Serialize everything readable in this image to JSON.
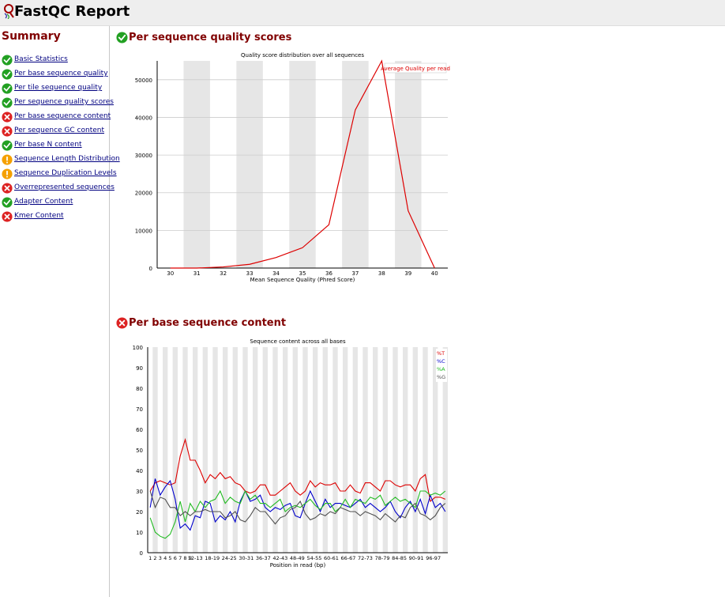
{
  "header": {
    "title": "FastQC Report"
  },
  "sidebar": {
    "title": "Summary",
    "items": [
      {
        "label": "Basic Statistics",
        "status": "pass"
      },
      {
        "label": "Per base sequence quality",
        "status": "pass"
      },
      {
        "label": "Per tile sequence quality",
        "status": "pass"
      },
      {
        "label": "Per sequence quality scores",
        "status": "pass"
      },
      {
        "label": "Per base sequence content",
        "status": "fail"
      },
      {
        "label": "Per sequence GC content",
        "status": "fail"
      },
      {
        "label": "Per base N content",
        "status": "pass"
      },
      {
        "label": "Sequence Length Distribution",
        "status": "warn"
      },
      {
        "label": "Sequence Duplication Levels",
        "status": "warn"
      },
      {
        "label": "Overrepresented sequences",
        "status": "fail"
      },
      {
        "label": "Adapter Content",
        "status": "pass"
      },
      {
        "label": "Kmer Content",
        "status": "fail"
      }
    ]
  },
  "sections": {
    "quality": {
      "title": "Per sequence quality scores",
      "status": "pass"
    },
    "content": {
      "title": "Per base sequence content",
      "status": "fail"
    }
  },
  "colors": {
    "pass": "#22a022",
    "fail": "#dd2222",
    "warn": "#f5a000",
    "heading": "#800000",
    "link": "#000080"
  },
  "chart_data": [
    {
      "type": "line",
      "title": "Quality score distribution over all sequences",
      "xlabel": "Mean Sequence Quality (Phred Score)",
      "ylabel": "",
      "x": [
        30,
        31,
        32,
        33,
        34,
        35,
        36,
        37,
        38,
        39,
        40
      ],
      "xlim": [
        30,
        40
      ],
      "ylim": [
        0,
        55000
      ],
      "yticks": [
        0,
        10000,
        20000,
        30000,
        40000,
        50000
      ],
      "grid": true,
      "legend_position": "top-right",
      "series": [
        {
          "name": "Average Quality per read",
          "color": "#dd0000",
          "values": [
            0,
            0,
            300,
            1000,
            2800,
            5400,
            11500,
            42000,
            55000,
            15200,
            0
          ]
        }
      ]
    },
    {
      "type": "line",
      "title": "Sequence content across all bases",
      "xlabel": "Position in read (bp)",
      "ylabel": "",
      "categories": [
        "1",
        "2",
        "3",
        "4",
        "5",
        "6",
        "7",
        "8",
        "9",
        "12-13",
        "18-19",
        "24-25",
        "30-31",
        "36-37",
        "42-43",
        "48-49",
        "54-55",
        "60-61",
        "66-67",
        "72-73",
        "78-79",
        "84-85",
        "90-91",
        "96-97"
      ],
      "n_points": 60,
      "ylim": [
        0,
        100
      ],
      "yticks": [
        0,
        10,
        20,
        30,
        40,
        50,
        60,
        70,
        80,
        90,
        100
      ],
      "grid": true,
      "legend_position": "top-right",
      "series": [
        {
          "name": "%T",
          "color": "#dd0000",
          "values": [
            30,
            34,
            35,
            34,
            33,
            34,
            47,
            55,
            45,
            45,
            40,
            34,
            38,
            36,
            39,
            36,
            37,
            34,
            33,
            30,
            29,
            30,
            33,
            33,
            28,
            28,
            30,
            32,
            34,
            30,
            28,
            30,
            35,
            32,
            34,
            33,
            33,
            34,
            30,
            30,
            33,
            30,
            29,
            34,
            34,
            32,
            30,
            35,
            35,
            33,
            32,
            33,
            33,
            30,
            36,
            38,
            25,
            27,
            27,
            26
          ]
        },
        {
          "name": "%C",
          "color": "#0000cc",
          "values": [
            22,
            36,
            28,
            32,
            35,
            26,
            12,
            14,
            11,
            18,
            17,
            25,
            24,
            15,
            18,
            16,
            20,
            15,
            25,
            30,
            25,
            26,
            28,
            22,
            20,
            22,
            21,
            23,
            24,
            18,
            17,
            24,
            30,
            25,
            20,
            26,
            22,
            24,
            24,
            23,
            22,
            24,
            26,
            22,
            24,
            22,
            20,
            22,
            25,
            20,
            17,
            22,
            25,
            20,
            26,
            19,
            28,
            22,
            24,
            20
          ]
        },
        {
          "name": "%A",
          "color": "#22bb22",
          "values": [
            17,
            10,
            8,
            7,
            9,
            15,
            25,
            15,
            24,
            20,
            25,
            22,
            25,
            26,
            30,
            24,
            27,
            25,
            24,
            30,
            26,
            28,
            24,
            24,
            22,
            24,
            26,
            20,
            22,
            23,
            22,
            24,
            26,
            23,
            21,
            24,
            24,
            20,
            22,
            26,
            22,
            26,
            25,
            24,
            27,
            26,
            28,
            23,
            25,
            27,
            25,
            26,
            24,
            22,
            30,
            30,
            28,
            29,
            28,
            30
          ]
        },
        {
          "name": "%G",
          "color": "#505050",
          "values": [
            30,
            22,
            27,
            26,
            22,
            22,
            18,
            20,
            18,
            20,
            20,
            21,
            20,
            20,
            20,
            17,
            18,
            20,
            16,
            15,
            18,
            22,
            20,
            20,
            17,
            14,
            17,
            18,
            21,
            22,
            25,
            19,
            16,
            17,
            19,
            18,
            20,
            19,
            22,
            21,
            20,
            20,
            18,
            20,
            19,
            18,
            16,
            19,
            17,
            15,
            18,
            17,
            22,
            24,
            19,
            18,
            16,
            18,
            22,
            24
          ]
        }
      ]
    }
  ]
}
